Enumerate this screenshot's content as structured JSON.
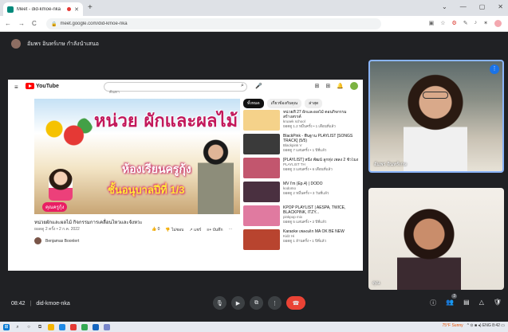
{
  "browser": {
    "tab_title": "Meet - did-kmoe-nka",
    "new_tab": "+",
    "window_controls": [
      "⌄",
      "—",
      "▢",
      "✕"
    ],
    "url": "meet.google.com/did-kmoe-nka",
    "nav": [
      "←",
      "→",
      "C"
    ],
    "extension_icons": [
      "▣",
      "☆",
      "⚙",
      "✎",
      "♪",
      "✶"
    ]
  },
  "presenter": {
    "name": "อัมพร อินทร์เกษ กำลังนำเสนอ"
  },
  "youtube": {
    "logo_text": "YouTube",
    "search_placeholder": "ค้นหา",
    "video": {
      "title_art": "หน่วย ผักและผลไม้",
      "line1": "ห้องเรียนครูกุ้ง",
      "line2": "ชั้นอนุบาลปีที่ 1/3",
      "tag": "คุณครูกุ้ง",
      "caption": "หน่วยผักและผลไม้ กิจกรรมการเคลื่อนไหวและจังหวะ",
      "meta": "ยอดดู 2 ครั้ง • 2 ก.ค. 2022",
      "likes": "0",
      "dislike_label": "ไม่ชอบ",
      "share": "แชร์",
      "save": "บันทึก",
      "channel": "Benjamas Boonlert"
    },
    "chips": [
      "ทั้งหมด",
      "เกี่ยวข้องกับคุณ",
      "ล่าสุด"
    ],
    "related": [
      {
        "title": "หน่วยที่ 27 ผักและผลไม้ ตอนกิจกรรมสร้างสรรค์",
        "channel": "kruaek school",
        "meta": "ยอดดู 1.2 หมื่นครั้ง • 1 เดือนที่แล้ว",
        "color": "#f5d28a"
      },
      {
        "title": "BlackPink - พื้นฐาน PLAYLIST [SONGS TRACK] (5/5)",
        "channel": "Blackpink V",
        "meta": "ยอดดู 7 แสนครั้ง • 1 ปีที่แล้ว",
        "color": "#3a3a3a"
      },
      {
        "title": "[PLAYLIST] หนึ่ง พัฒน์ ลูกทุ่ง เพลง 2 ชั่วโมง",
        "channel": "PLAYLIST TH",
        "meta": "ยอดดู 3 แสนครั้ง • 6 เดือนที่แล้ว",
        "color": "#c2566e"
      },
      {
        "title": "MV I'm (Ep.4) | DODO",
        "channel": "kodomo",
        "meta": "ยอดดู 2 หมื่นครั้ง • 3 วันที่แล้ว",
        "color": "#4a3040"
      },
      {
        "title": "KPOP PLAYLIST | AESPA, TWICE, BLACKPINK, ITZY...",
        "channel": "pinkpop mix",
        "meta": "ยอดดู 5 แสนครั้ง • 2 ปีที่แล้ว",
        "color": "#e07aa0"
      },
      {
        "title": "Karaoke เพลงเด็ก MA OK BE NEW",
        "channel": "Kidz Hi",
        "meta": "ยอดดู 1 ล้านครั้ง • 1 ปีที่แล้ว",
        "color": "#b8442f"
      }
    ]
  },
  "participants": [
    {
      "name": "อัมพร อินทร์เกษ",
      "speaking": true
    },
    {
      "name": "คุณ",
      "speaking": false
    }
  ],
  "meeting": {
    "time": "08:42",
    "code": "did-kmoe-nka",
    "separator": "|",
    "people_count": "3"
  },
  "taskbar": {
    "weather": "75°F Sunny",
    "tray": "^ ⊙ ■ ◂) ENG 8:42 ▭"
  }
}
